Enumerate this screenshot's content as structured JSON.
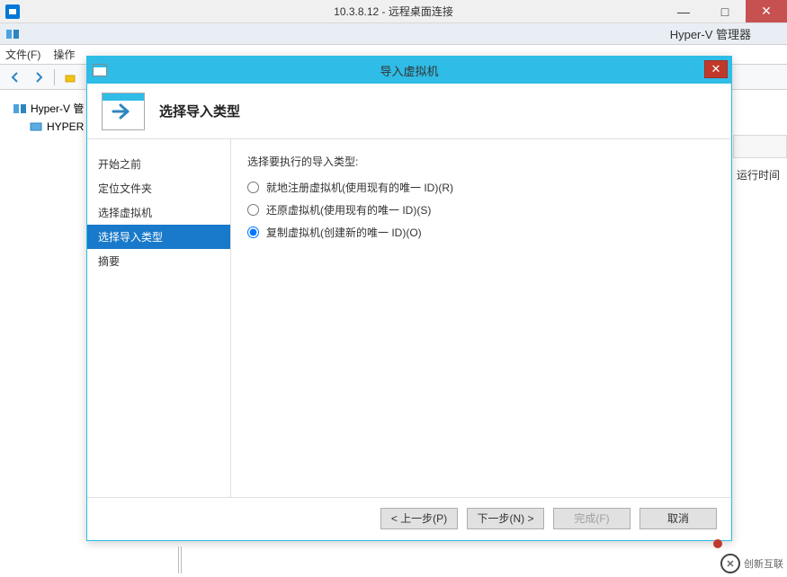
{
  "rdp": {
    "title": "10.3.8.12 - 远程桌面连接"
  },
  "hyperv": {
    "app_title": "Hyper-V 管理器",
    "menu": {
      "file": "文件(F)",
      "action": "操作"
    },
    "tree": {
      "root": "Hyper-V 管",
      "child": "HYPER"
    },
    "right_label": "运行时间"
  },
  "dialog": {
    "title": "导入虚拟机",
    "heading": "选择导入类型",
    "nav": {
      "before": "开始之前",
      "locate": "定位文件夹",
      "select_vm": "选择虚拟机",
      "import_type": "选择导入类型",
      "summary": "摘要"
    },
    "prompt": "选择要执行的导入类型:",
    "radios": {
      "register": "就地注册虚拟机(使用现有的唯一 ID)(R)",
      "restore": "还原虚拟机(使用现有的唯一 ID)(S)",
      "copy": "复制虚拟机(创建新的唯一 ID)(O)"
    },
    "buttons": {
      "prev": "< 上一步(P)",
      "next": "下一步(N) >",
      "finish": "完成(F)",
      "cancel": "取消"
    }
  },
  "watermark": {
    "text": "创新互联"
  }
}
